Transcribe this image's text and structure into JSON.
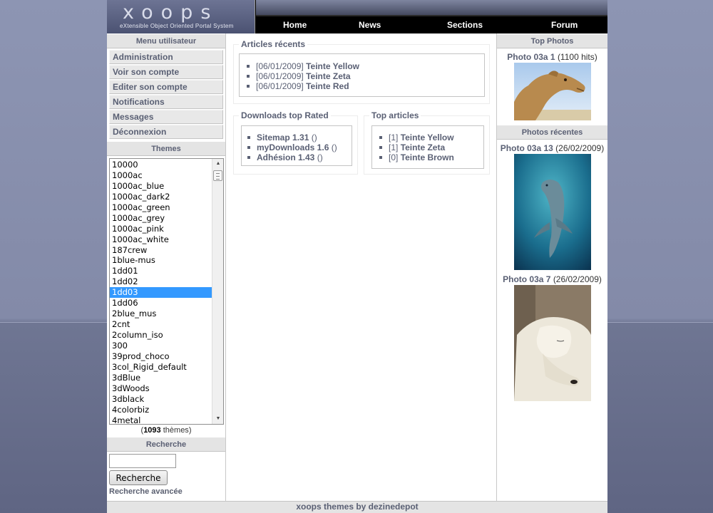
{
  "header": {
    "logo_text": "xoops",
    "logo_subtitle": "eXtensible Object Oriented Portal System",
    "nav": [
      "Home",
      "News",
      "Sections",
      "Forum"
    ]
  },
  "user_menu": {
    "title": "Menu utilisateur",
    "items": [
      "Administration",
      "Voir son compte",
      "Editer son compte",
      "Notifications",
      "Messages",
      "Déconnexion"
    ]
  },
  "themes": {
    "title": "Themes",
    "options": [
      "10000",
      "1000ac",
      "1000ac_blue",
      "1000ac_dark2",
      "1000ac_green",
      "1000ac_grey",
      "1000ac_pink",
      "1000ac_white",
      "187crew",
      "1blue-mus",
      "1dd01",
      "1dd02",
      "1dd03",
      "1dd06",
      "2blue_mus",
      "2cnt",
      "2column_iso",
      "300",
      "39prod_choco",
      "3col_Rigid_default",
      "3dBlue",
      "3dWoods",
      "3dblack",
      "4colorbiz",
      "4metal"
    ],
    "selected": "1dd03",
    "count": "1093",
    "count_suffix": "thèmes"
  },
  "search": {
    "title": "Recherche",
    "value": "",
    "button_label": "Recherche",
    "advanced_label": "Recherche avancée"
  },
  "recent_articles": {
    "title": "Articles récents",
    "items": [
      {
        "date": "[06/01/2009]",
        "title": "Teinte Yellow"
      },
      {
        "date": "[06/01/2009]",
        "title": "Teinte Zeta"
      },
      {
        "date": "[06/01/2009]",
        "title": "Teinte Red"
      }
    ]
  },
  "downloads_top": {
    "title": "Downloads top Rated",
    "items": [
      {
        "name": "Sitemap 1.31",
        "extra": "()"
      },
      {
        "name": "myDownloads 1.6",
        "extra": "()"
      },
      {
        "name": "Adhésion 1.43",
        "extra": "()"
      }
    ]
  },
  "top_articles": {
    "title": "Top articles",
    "items": [
      {
        "count": "[1]",
        "title": "Teinte Yellow"
      },
      {
        "count": "[1]",
        "title": "Teinte Zeta"
      },
      {
        "count": "[0]",
        "title": "Teinte Brown"
      }
    ]
  },
  "top_photos": {
    "title": "Top Photos",
    "items": [
      {
        "name": "Photo 03a 1",
        "meta": "(1100 hits)",
        "icon": "camel-photo"
      }
    ]
  },
  "recent_photos": {
    "title": "Photos récentes",
    "items": [
      {
        "name": "Photo 03a 13",
        "meta": "(26/02/2009)",
        "icon": "dolphin-photo"
      },
      {
        "name": "Photo 03a 7",
        "meta": "(26/02/2009)",
        "icon": "polar-bear-photo"
      }
    ]
  },
  "footer": {
    "text": "xoops themes by dezinedepot"
  },
  "colors": {
    "accent": "#5a6074",
    "selected": "#3399ff",
    "nav_bg": "#000000"
  }
}
